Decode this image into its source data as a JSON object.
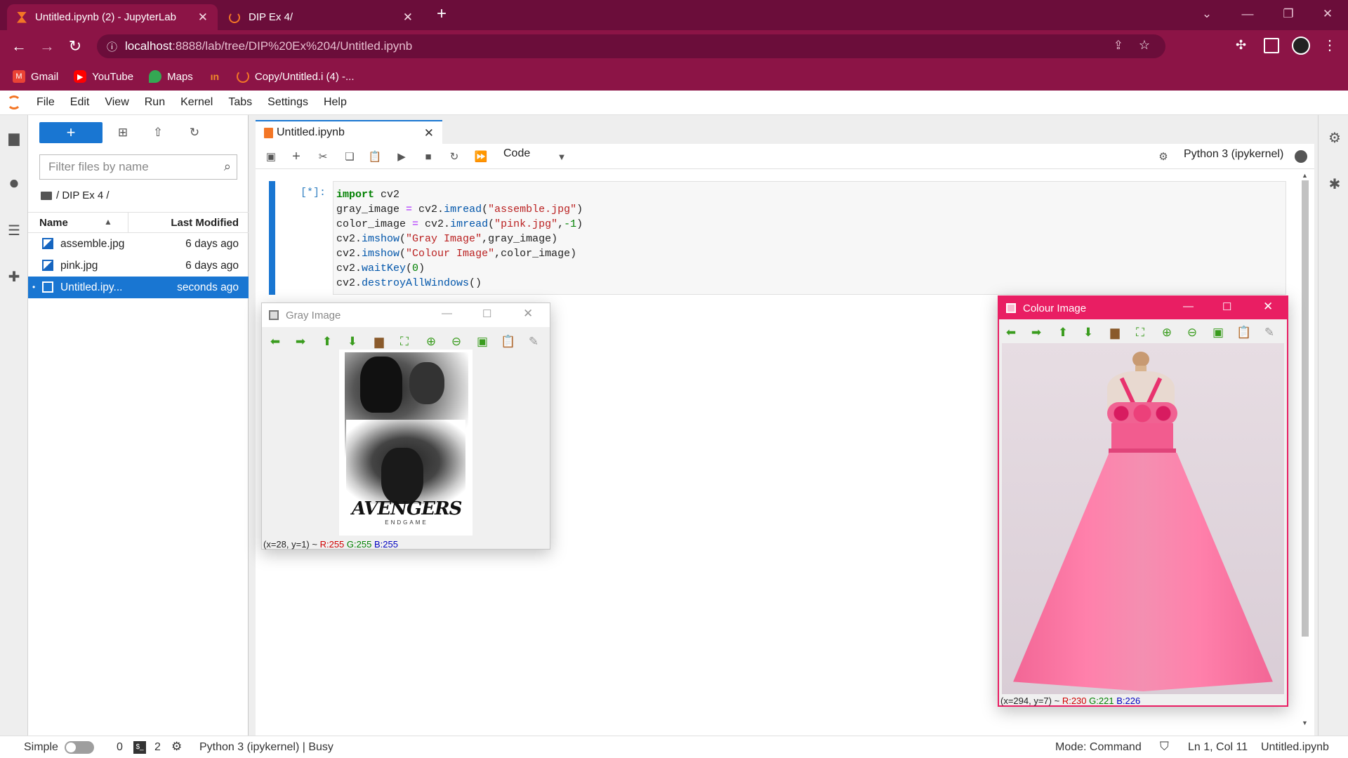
{
  "browser": {
    "tabs": [
      {
        "title": "Untitled.ipynb (2) - JupyterLab",
        "active": true
      },
      {
        "title": "DIP Ex 4/",
        "active": false
      }
    ],
    "new_tab": "+",
    "url_host": "localhost",
    "url_path": ":8888/lab/tree/DIP%20Ex%204/Untitled.ipynb",
    "bookmarks": [
      {
        "label": "Gmail",
        "color": "#ea4335"
      },
      {
        "label": "YouTube",
        "color": "#ff0000"
      },
      {
        "label": "Maps",
        "color": "#34a853"
      },
      {
        "label": "",
        "color": "#f28c28"
      },
      {
        "label": "Copy/Untitled.i (4) -...",
        "color": "#f37626"
      }
    ]
  },
  "jupyter": {
    "menu": [
      "File",
      "Edit",
      "View",
      "Run",
      "Kernel",
      "Tabs",
      "Settings",
      "Help"
    ],
    "filebrowser": {
      "new_label": "+",
      "filter_placeholder": "Filter files by name",
      "breadcrumb": "/ DIP Ex 4 /",
      "col_name": "Name",
      "col_modified": "Last Modified",
      "files": [
        {
          "name": "assemble.jpg",
          "modified": "6 days ago",
          "selected": false
        },
        {
          "name": "pink.jpg",
          "modified": "6 days ago",
          "selected": false
        },
        {
          "name": "Untitled.ipy...",
          "modified": "seconds ago",
          "selected": true
        }
      ]
    },
    "doc_tab": "Untitled.ipynb",
    "cell_type": "Code",
    "kernel": "Python 3 (ipykernel)",
    "cell": {
      "prompt": "[*]:",
      "lines": [
        "import cv2",
        "gray_image = cv2.imread(\"assemble.jpg\")",
        "color_image = cv2.imread(\"pink.jpg\",-1)",
        "cv2.imshow(\"Gray Image\",gray_image)",
        "cv2.imshow(\"Colour Image\",color_image)",
        "cv2.waitKey(0)",
        "cv2.destroyAllWindows()"
      ]
    },
    "status": {
      "mode_simple": "Simple",
      "count_a": "0",
      "count_b": "2",
      "kernel_status": "Python 3 (ipykernel) | Busy",
      "mode": "Mode: Command",
      "position": "Ln 1, Col 11",
      "file": "Untitled.ipynb"
    }
  },
  "gray_window": {
    "title": "Gray Image",
    "poster_text": "AVENGERS",
    "poster_sub": "ENDGAME",
    "status_xy": "(x=28, y=1) ~",
    "r": "R:255",
    "g": "G:255",
    "b": "B:255"
  },
  "colour_window": {
    "title": "Colour Image",
    "status_xy": "(x=294, y=7) ~",
    "r": "R:230",
    "g": "G:221",
    "b": "B:226"
  },
  "colors": {
    "chrome_dark": "#6b0d3a",
    "chrome_main": "#8c1446",
    "jupyter_blue": "#1976d2",
    "colour_window_title": "#e91e63"
  }
}
